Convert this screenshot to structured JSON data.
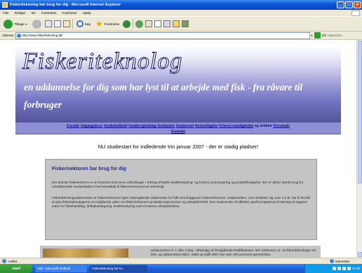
{
  "window": {
    "title": "Fiskeriteknolog har brug for dig - Microsoft Internet Explorer"
  },
  "menu": [
    "Filer",
    "Rediger",
    "Vis",
    "Foretrukne",
    "Funktioner",
    "Hjælp"
  ],
  "toolbar": {
    "back_label": "Tilbage",
    "search_label": "Søg",
    "favorites_label": "Foretrukne"
  },
  "address": {
    "label": "Adresse",
    "url": "http://www.fiskeriteknolog.dk/",
    "go_label": "Gå",
    "links_label": "Hyperlinks"
  },
  "page": {
    "site_title": "Fiskeriteknolog",
    "tagline": "en uddannelse for dig som har lyst til at arbejde med fisk - fra råvare til forbruger",
    "nav": [
      {
        "label": "Forside",
        "link": true
      },
      {
        "label": "Adgangskrav",
        "link": true
      },
      {
        "label": "Studieindhold",
        "link": true
      },
      {
        "label": "Studievejledning",
        "link": true
      },
      {
        "label": "Institutter",
        "link": true
      },
      {
        "label": "Studiestart",
        "link": true
      },
      {
        "label": "Beskæftigelse",
        "link": true
      },
      {
        "label": "Erhvervsmuligheder",
        "link": true
      },
      {
        "label": "og artikler",
        "link": false
      },
      {
        "label": "Personale",
        "link": true
      },
      {
        "label": "Kontakt",
        "link": true
      }
    ],
    "announcement": "NU studiestart for indledende trin januar 2007 - der er stadig pladser!",
    "infobox": {
      "title": "Fiskerisektoren har brug for dig",
      "para1": "Det danske fiskerierhverv er en branche med store udfordringer i retning af bedre kvalitetsstyring- og kontrol, processtyring og produktforøgelse. Der er derfor stærkt brug for veluddannede medarbejdere med kendskab til fiskeriressourcernes teknologi.",
      "para2": "Fiskeriteknologuddannelsen er fiskerisektorens egen videregående uddannelse for folk med baggrund i fiskerierhvervet. Uddannelsen, som strækker sig over 1-2 år, har til formål at give fiskeriteknologerne en indgående viden om fiskerisektorens produktionsprocesser og arbejdsforhold. Den studerende vil således opnå kompetence til løsning af opgaver inden for fiskehandling, driftsplanlægning, kvalitetsstyring samt moderne arbejdsledelse."
    },
    "lowerbox": {
      "text": "Uddannelsen er 1 eller 2 årig - afhængig af forudgående kvalifikationer. Der uddannes ca. 15 fiskeriteknologer om året, og uddannelsen blev i 1989 og indtil 2007 har over 200 personer gennemført."
    }
  },
  "status": {
    "left": "Udført",
    "zone": "Internettet"
  },
  "taskbar": {
    "start": "start",
    "tasks": [
      "Mail - Microsoft Outlook",
      "Fiskeriteknolog har br..."
    ],
    "clock": "10:28"
  }
}
